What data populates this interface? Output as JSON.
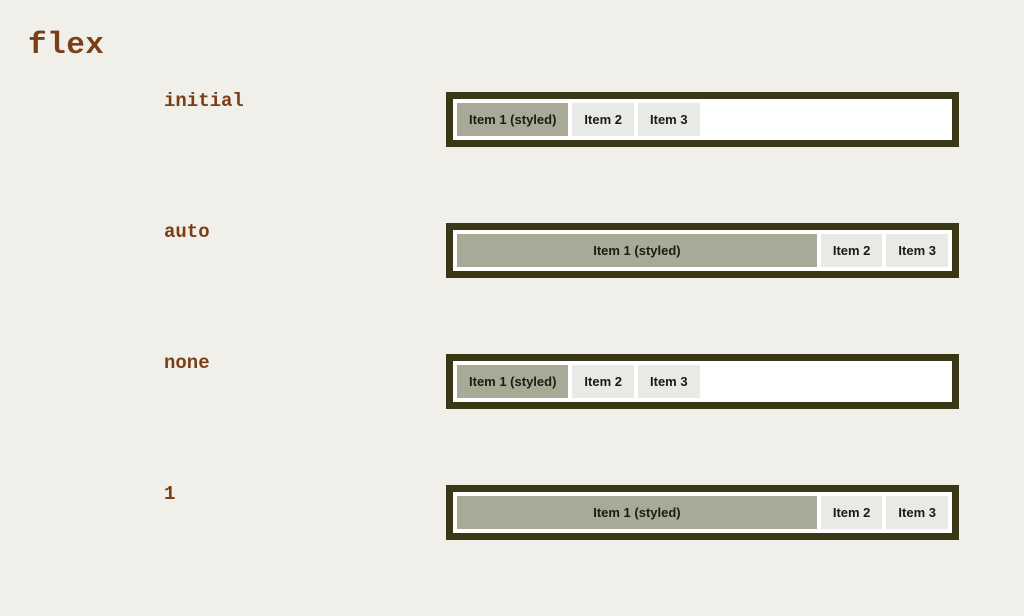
{
  "slide": {
    "title": "flex",
    "title_color": "#7b3f15",
    "background_color": "#f0efe9",
    "container_border_color": "#3a3717",
    "container_background_color": "#ffffff",
    "styled_item_color": "#a9a998",
    "plain_item_color": "#e9e9e5",
    "item_text_color": "#1b1b12"
  },
  "rows": [
    {
      "label": "initial",
      "variant": "initial",
      "items": [
        {
          "label": "Item 1 (styled)",
          "styled": true
        },
        {
          "label": "Item 2",
          "styled": false
        },
        {
          "label": "Item 3",
          "styled": false
        }
      ]
    },
    {
      "label": "auto",
      "variant": "auto",
      "items": [
        {
          "label": "Item 1 (styled)",
          "styled": true
        },
        {
          "label": "Item 2",
          "styled": false
        },
        {
          "label": "Item 3",
          "styled": false
        }
      ]
    },
    {
      "label": "none",
      "variant": "none",
      "items": [
        {
          "label": "Item 1 (styled)",
          "styled": true
        },
        {
          "label": "Item 2",
          "styled": false
        },
        {
          "label": "Item 3",
          "styled": false
        }
      ]
    },
    {
      "label": "1",
      "variant": "one",
      "items": [
        {
          "label": "Item 1 (styled)",
          "styled": true
        },
        {
          "label": "Item 2",
          "styled": false
        },
        {
          "label": "Item 3",
          "styled": false
        }
      ]
    }
  ]
}
